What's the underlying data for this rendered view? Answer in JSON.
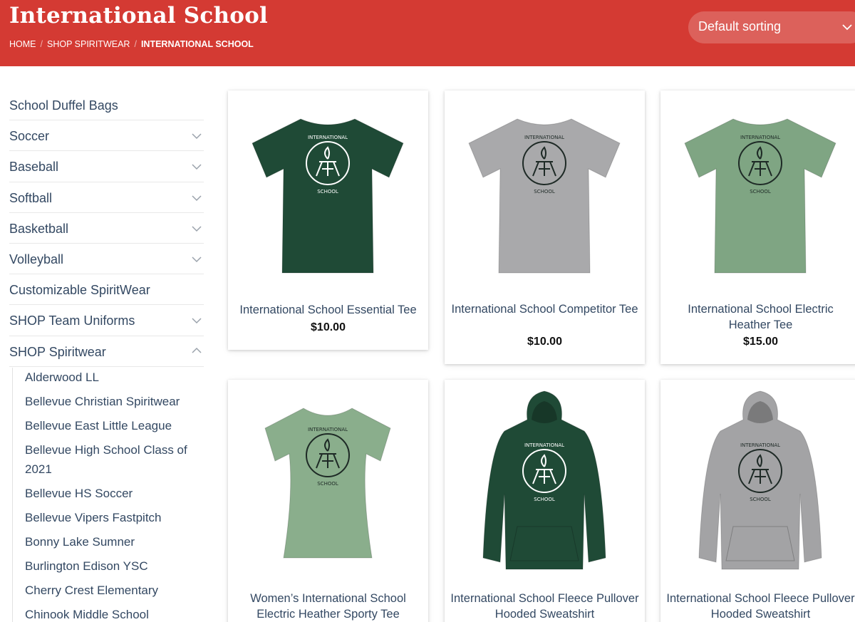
{
  "header": {
    "title": "International School",
    "breadcrumb": [
      "HOME",
      "SHOP SPIRITWEAR",
      "INTERNATIONAL SCHOOL"
    ],
    "sort_label": "Default sorting",
    "bg_color": "#d43a33"
  },
  "sidebar": {
    "categories": [
      {
        "label": "School Duffel Bags",
        "toggle": "none"
      },
      {
        "label": "Soccer",
        "toggle": "chevron-down-icon"
      },
      {
        "label": "Baseball",
        "toggle": "chevron-down-icon"
      },
      {
        "label": "Softball",
        "toggle": "chevron-down-icon"
      },
      {
        "label": "Basketball",
        "toggle": "chevron-down-icon"
      },
      {
        "label": "Volleyball",
        "toggle": "chevron-down-icon"
      },
      {
        "label": "Customizable SpiritWear",
        "toggle": "none"
      },
      {
        "label": "SHOP Team Uniforms",
        "toggle": "chevron-down-icon"
      },
      {
        "label": "SHOP Spiritwear",
        "toggle": "chevron-up-icon"
      }
    ],
    "subcategories": [
      "Alderwood LL",
      "Bellevue Christian Spiritwear",
      "Bellevue East Little League",
      "Bellevue High School Class of 2021",
      "Bellevue HS Soccer",
      "Bellevue Vipers Fastpitch",
      "Bonny Lake Sumner",
      "Burlington Edison YSC",
      "Cherry Crest Elementary",
      "Chinook Middle School"
    ]
  },
  "products": [
    {
      "name": "International School Essential Tee",
      "price": "$10.00",
      "garment": "tee",
      "color": "#1f4a36"
    },
    {
      "name": "International School Competitor Tee",
      "price": "$10.00",
      "garment": "tee",
      "color": "#a9a9ab"
    },
    {
      "name": "International School Electric Heather Tee",
      "price": "$15.00",
      "garment": "tee",
      "color": "#7fa583"
    },
    {
      "name": "Women’s International School Electric Heather Sporty Tee",
      "price": "",
      "garment": "ladies-tee",
      "color": "#8aae8c"
    },
    {
      "name": "International School Fleece Pullover Hooded Sweatshirt",
      "price": "",
      "garment": "hoodie",
      "color": "#1f4a36"
    },
    {
      "name": "International School Fleece Pullover Hooded Sweatshirt",
      "price": "",
      "garment": "hoodie",
      "color": "#a3a3a5"
    }
  ],
  "logo_text": {
    "top": "INTERNATIONAL",
    "bottom": "SCHOOL"
  }
}
